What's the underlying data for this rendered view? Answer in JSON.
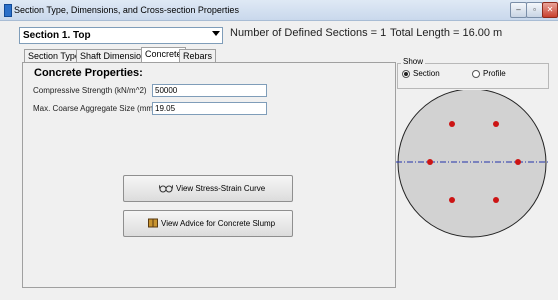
{
  "window": {
    "title": "Section Type, Dimensions, and Cross-section Properties"
  },
  "header": {
    "section_selected": "Section 1. Top",
    "defined_sections": "Number of Defined Sections = 1",
    "total_length": "Total Length = 16.00 m"
  },
  "tabs": [
    {
      "label": "Section Type"
    },
    {
      "label": "Shaft Dimensions"
    },
    {
      "label": "Concrete",
      "active": true
    },
    {
      "label": "Rebars"
    }
  ],
  "concrete": {
    "heading": "Concrete Properties:",
    "compressive_label": "Compressive Strength (kN/m^2)",
    "compressive_value": "50000",
    "aggregate_label": "Max. Coarse Aggregate Size (mm)",
    "aggregate_value": "19.05"
  },
  "buttons": {
    "stress_strain": "View Stress-Strain Curve",
    "slump": "View Advice for Concrete Slump"
  },
  "show": {
    "title": "Show",
    "options": [
      {
        "label": "Section",
        "selected": true
      },
      {
        "label": "Profile",
        "selected": false
      }
    ]
  },
  "colors": {
    "circle_fill": "#d2d2d2",
    "rebar": "#cc1414",
    "axis": "#2233aa"
  },
  "icons": {
    "stress_strain": "glasses-icon",
    "slump": "book-icon"
  }
}
